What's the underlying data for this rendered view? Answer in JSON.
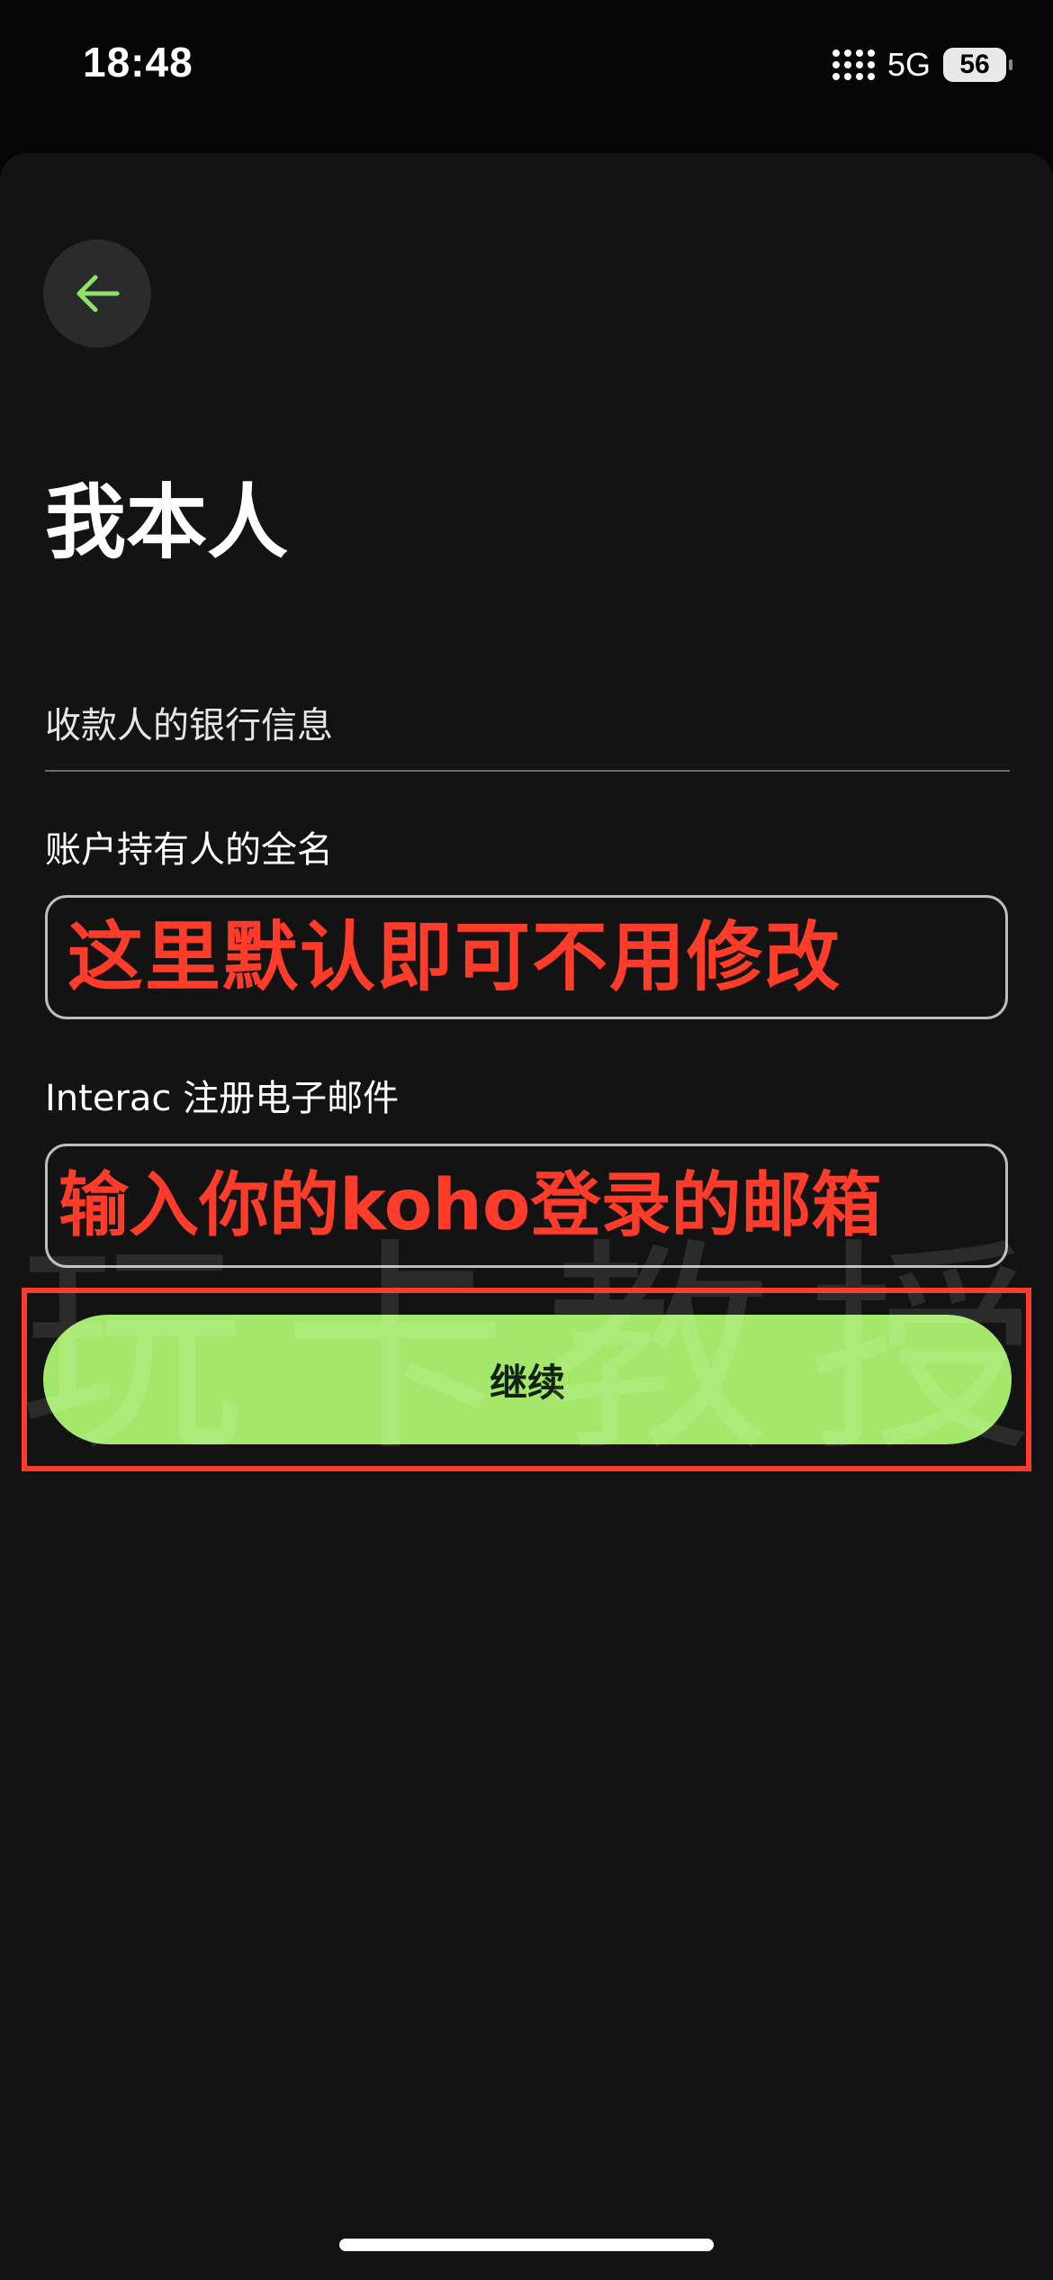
{
  "status_bar": {
    "time": "18:48",
    "network": "5G",
    "battery": "56"
  },
  "page": {
    "title": "我本人"
  },
  "form": {
    "section_label": "收款人的银行信息",
    "name_label": "账户持有人的全名",
    "name_overlay": "这里默认即可不用修改",
    "email_label": "Interac 注册电子邮件",
    "email_overlay": "输入你的koho登录的邮箱"
  },
  "actions": {
    "continue_label": "继续"
  },
  "watermark": {
    "text": "玩卡教授"
  },
  "colors": {
    "background": "#121312",
    "accent": "#a3e86a",
    "annotation": "#ff3b2a"
  },
  "icons": {
    "back": "arrow-left-icon",
    "signal": "signal-icon"
  }
}
